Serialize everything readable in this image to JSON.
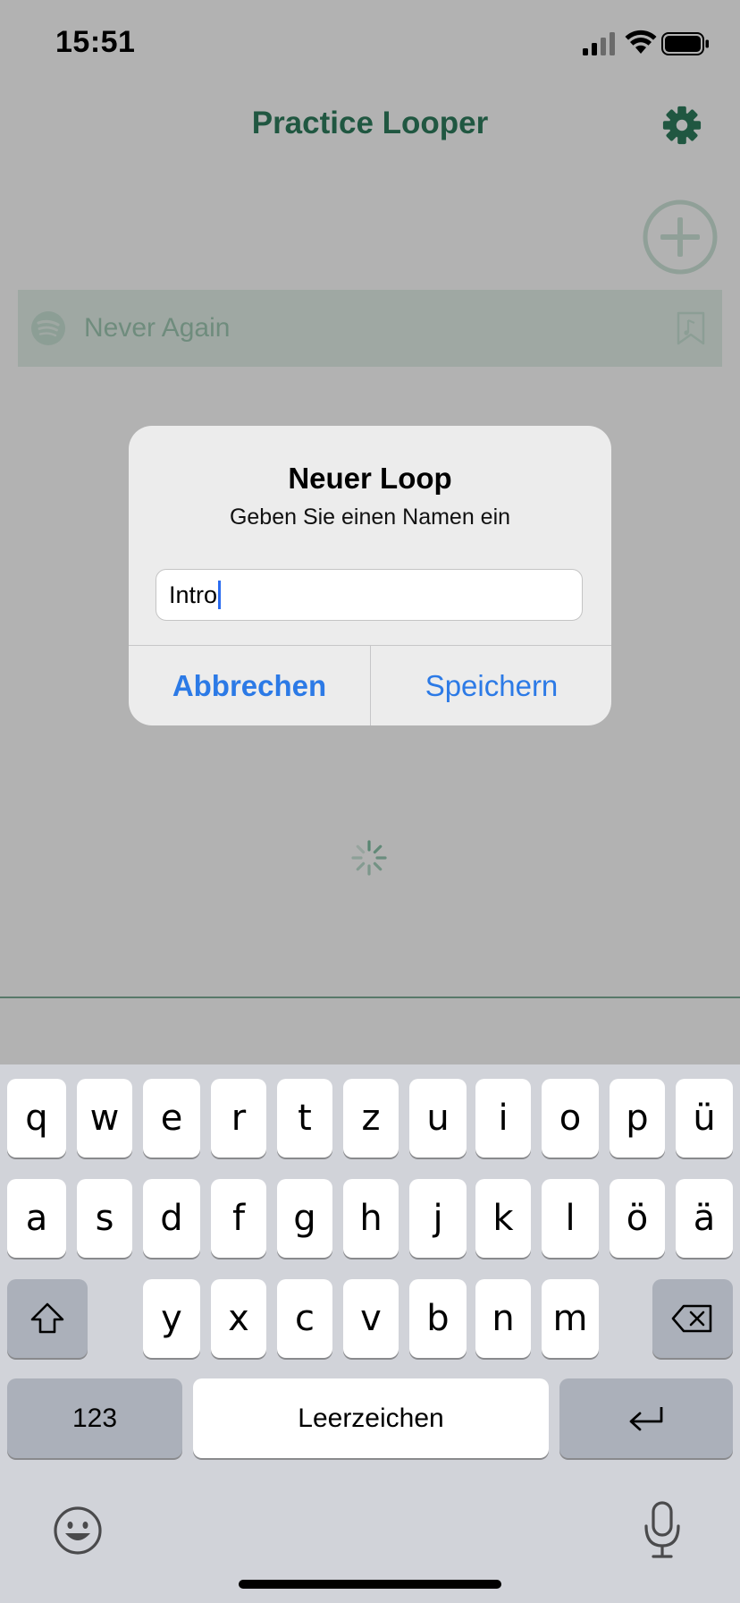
{
  "status_bar": {
    "time": "15:51"
  },
  "nav": {
    "title": "Practice Looper",
    "settings_icon": "gear-icon",
    "accent": "#2f7d5e"
  },
  "track": {
    "name": "Never Again",
    "source_icon": "spotify-icon",
    "bookmark_icon": "bookmark-icon"
  },
  "alert": {
    "title": "Neuer Loop",
    "message": "Geben Sie einen Namen ein",
    "input_value": "Intro",
    "cancel_label": "Abbrechen",
    "save_label": "Speichern",
    "button_color": "#2c7ae6"
  },
  "keyboard": {
    "row1": [
      "q",
      "w",
      "e",
      "r",
      "t",
      "z",
      "u",
      "i",
      "o",
      "p",
      "ü"
    ],
    "row2": [
      "a",
      "s",
      "d",
      "f",
      "g",
      "h",
      "j",
      "k",
      "l",
      "ö",
      "ä"
    ],
    "row3": [
      "y",
      "x",
      "c",
      "v",
      "b",
      "n",
      "m"
    ],
    "numbers_label": "123",
    "space_label": "Leerzeichen",
    "shift_icon": "shift-icon",
    "delete_icon": "delete-icon",
    "return_icon": "return-icon",
    "emoji_icon": "emoji-icon",
    "mic_icon": "microphone-icon"
  }
}
